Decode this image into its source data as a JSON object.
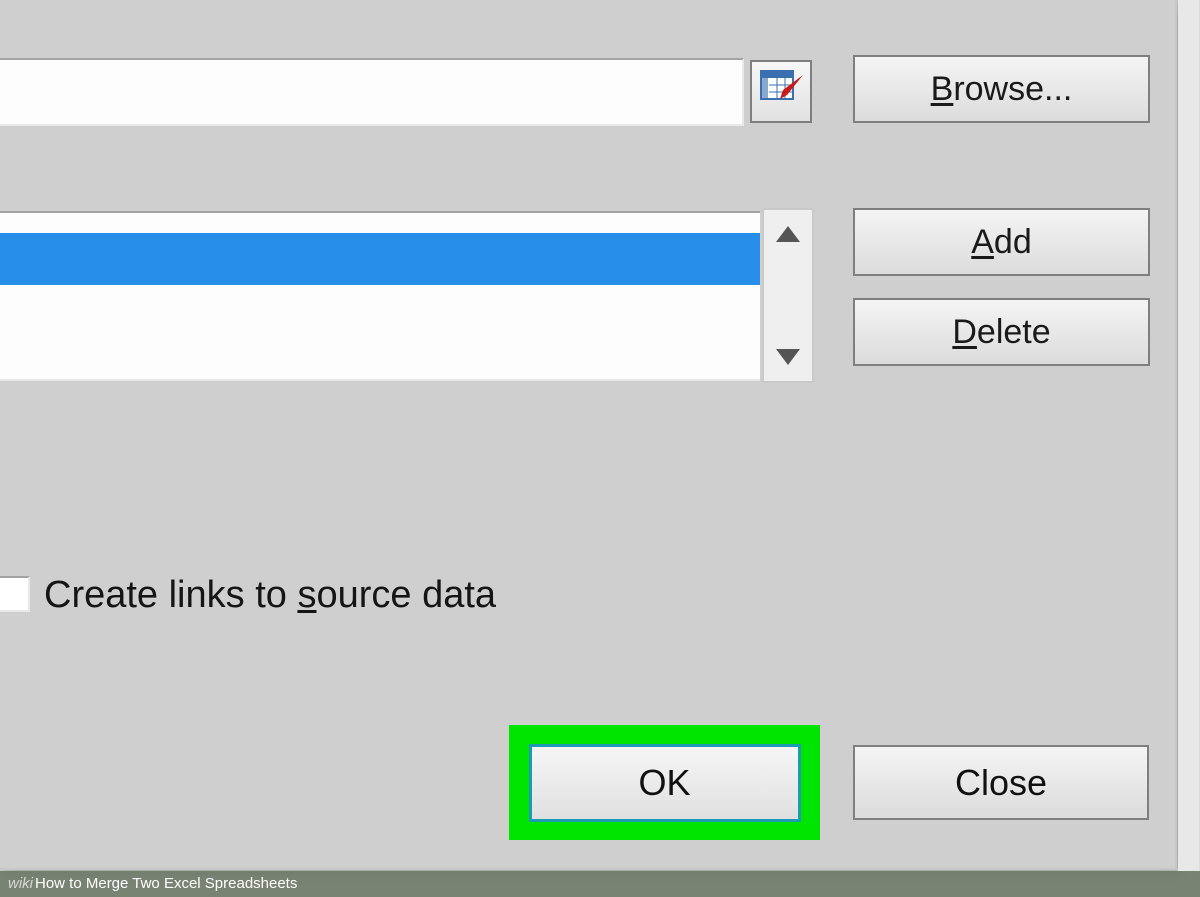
{
  "buttons": {
    "browse": "rowse...",
    "browse_pre": "B",
    "add": "dd",
    "add_pre": "A",
    "delete": "elete",
    "delete_pre": "D",
    "ok": "OK",
    "close": "Close"
  },
  "checkbox": {
    "label_pre": "Create links to ",
    "label_u": "s",
    "label_post": "ource data"
  },
  "caption": {
    "wiki": "wiki",
    "text": "How to Merge Two Excel Spreadsheets"
  }
}
